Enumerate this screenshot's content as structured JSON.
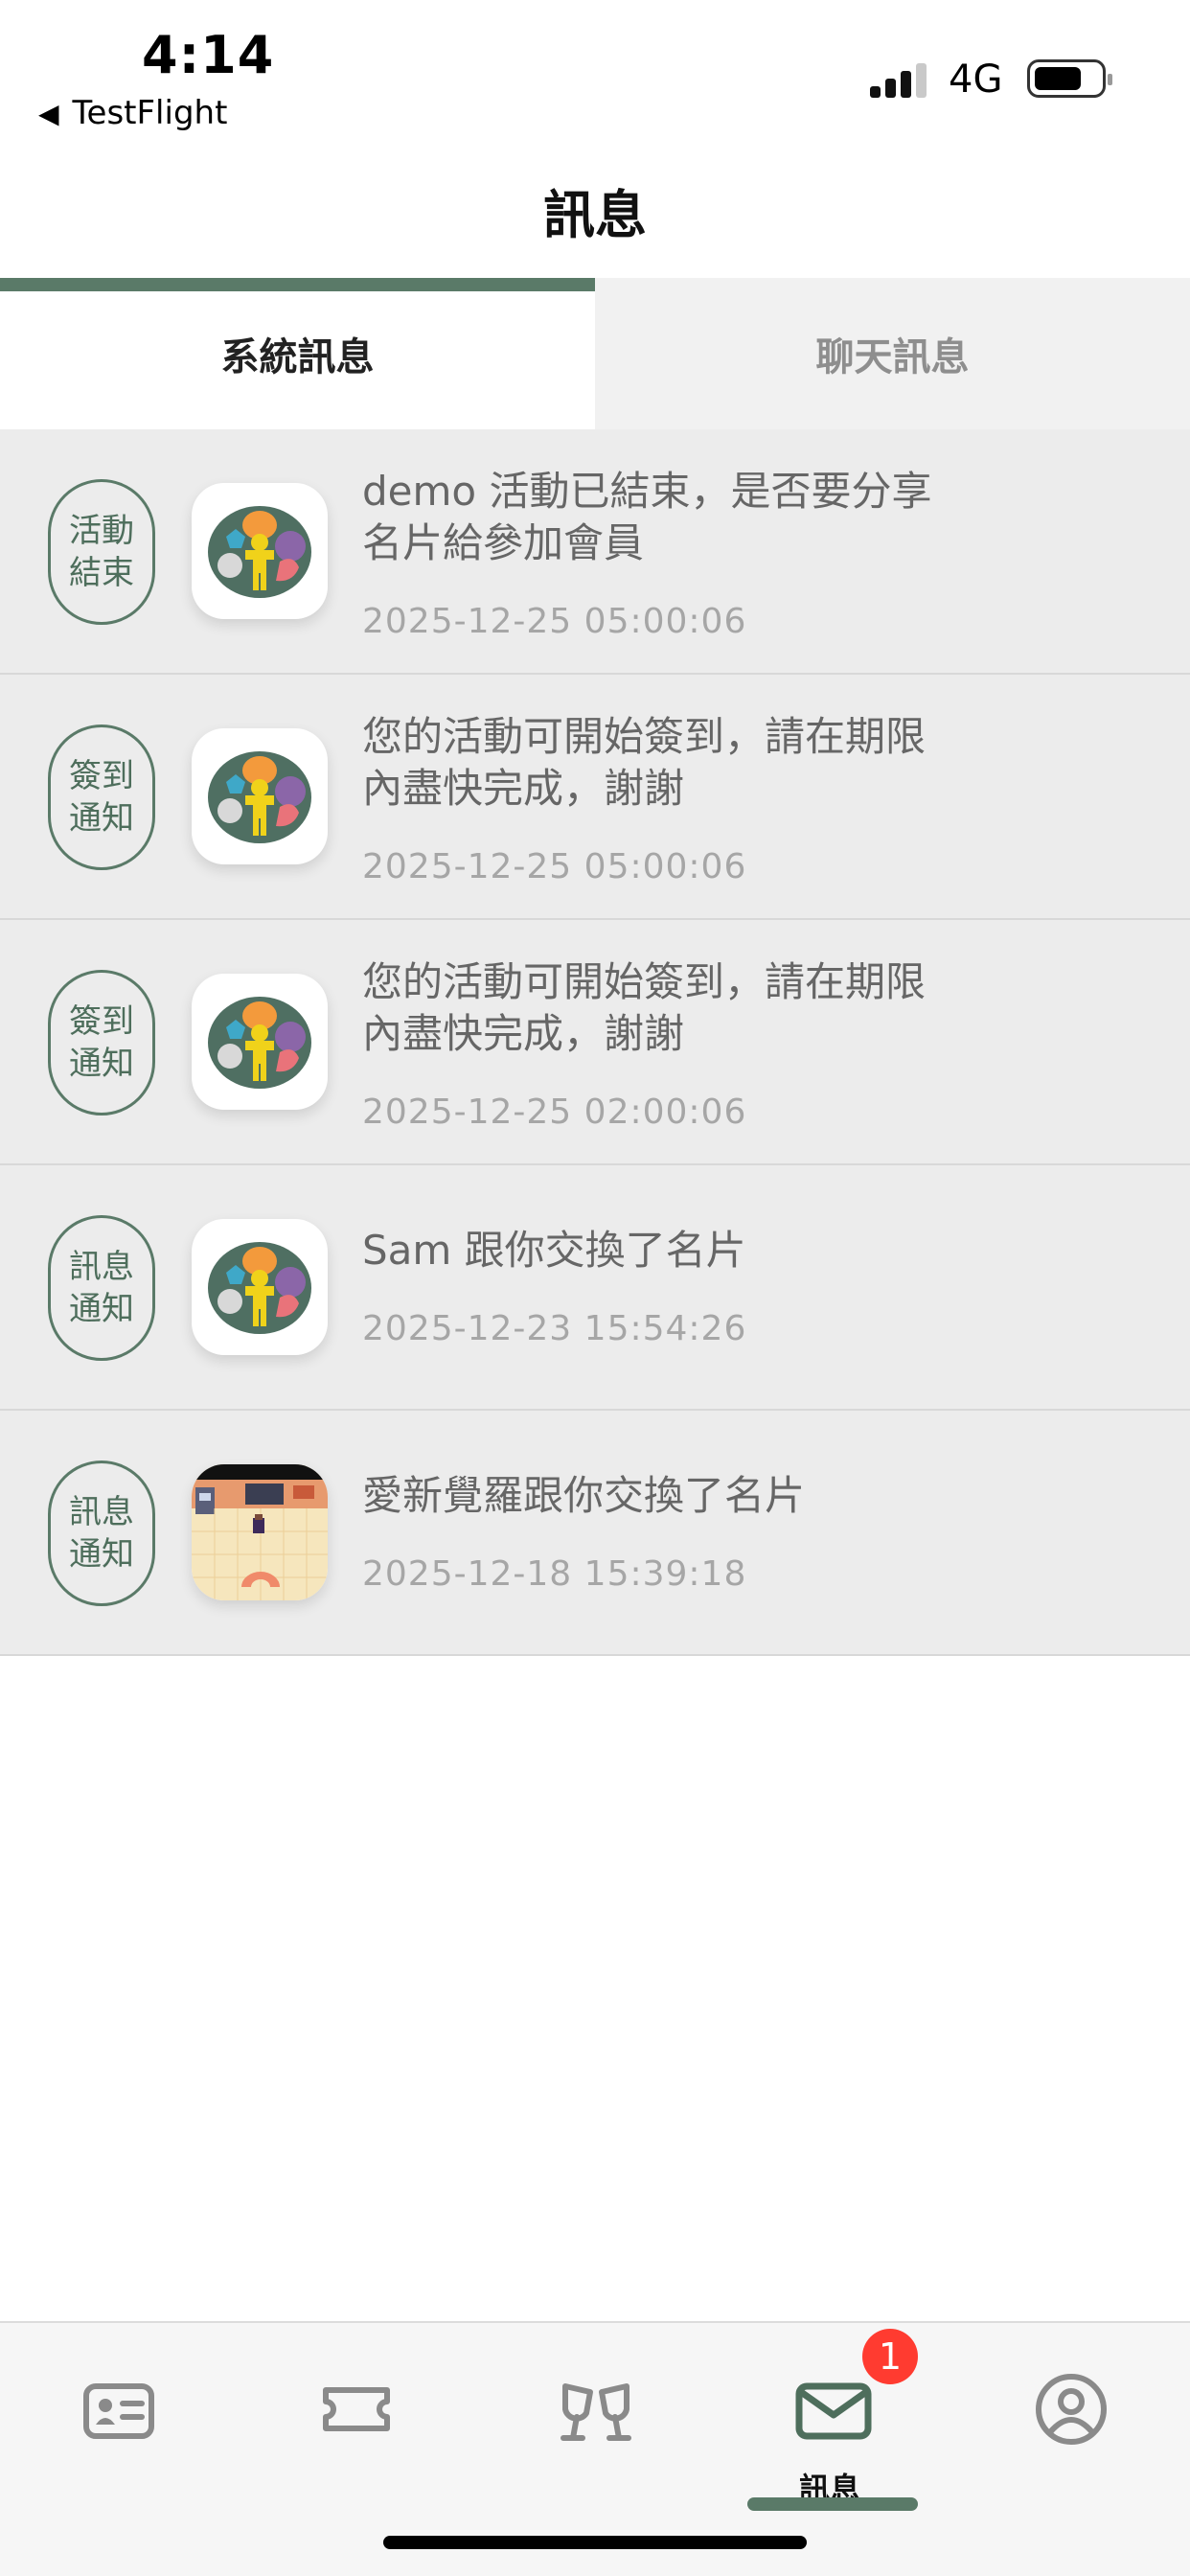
{
  "status_bar": {
    "time": "4:14",
    "back_app": "TestFlight",
    "network": "4G",
    "signal_bars": 3,
    "signal_bars_total": 4,
    "battery_level": 0.7
  },
  "header": {
    "title": "訊息"
  },
  "tabs": [
    {
      "label": "系統訊息",
      "active": true
    },
    {
      "label": "聊天訊息",
      "active": false
    }
  ],
  "messages": [
    {
      "tag_line1": "活動",
      "tag_line2": "結束",
      "avatar": "tree-logo",
      "line1": "demo 活動已結束，是否要分享",
      "line2": "名片給參加會員",
      "date": "2025-12-25 05:00:06"
    },
    {
      "tag_line1": "簽到",
      "tag_line2": "通知",
      "avatar": "tree-logo",
      "line1": "您的活動可開始簽到，請在期限",
      "line2": "內盡快完成，謝謝",
      "date": "2025-12-25 05:00:06"
    },
    {
      "tag_line1": "簽到",
      "tag_line2": "通知",
      "avatar": "tree-logo",
      "line1": "您的活動可開始簽到，請在期限",
      "line2": "內盡快完成，謝謝",
      "date": "2025-12-25 02:00:06"
    },
    {
      "tag_line1": "訊息",
      "tag_line2": "通知",
      "avatar": "tree-logo",
      "line1": "Sam 跟你交換了名片",
      "line2": "",
      "date": "2025-12-23 15:54:26"
    },
    {
      "tag_line1": "訊息",
      "tag_line2": "通知",
      "avatar": "pixel-room",
      "line1": "愛新覺羅跟你交換了名片",
      "line2": "",
      "date": "2025-12-18 15:39:18"
    }
  ],
  "bottom_nav": {
    "items": [
      {
        "icon": "id-card-icon"
      },
      {
        "icon": "ticket-icon"
      },
      {
        "icon": "cheers-icon"
      },
      {
        "icon": "mail-icon",
        "label": "訊息",
        "active": true,
        "badge": "1"
      },
      {
        "icon": "profile-icon"
      }
    ]
  },
  "colors": {
    "accent": "#5a7a68",
    "row_bg": "#ececec",
    "badge": "#ff3b30"
  }
}
